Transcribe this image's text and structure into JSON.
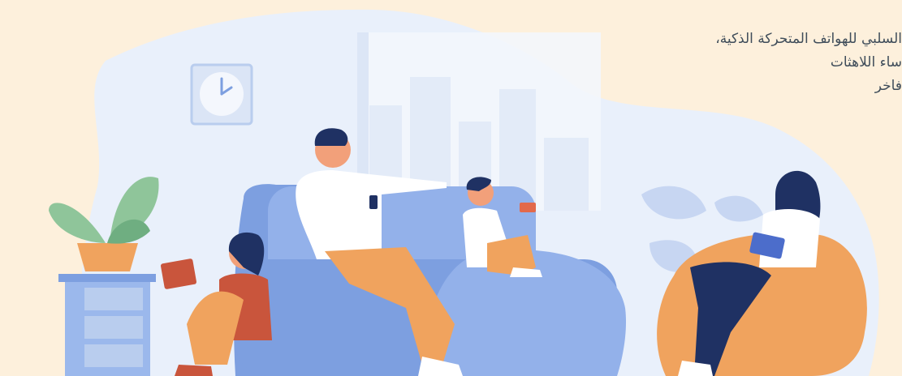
{
  "text": {
    "line1": "السلبي للهواتف المتحركة الذكية،",
    "line2": "ساء  اللاهثات",
    "line3": "فاخر"
  },
  "colors": {
    "background": "#fdf0dc",
    "blob": "#e9f0fb",
    "sofa": "#7d9fe0",
    "orange": "#f0a35e",
    "shirt": "#ffffff",
    "hair": "#1f3163",
    "skin": "#f2a07a"
  },
  "icons": [
    "wall-clock-icon",
    "potted-plant-icon",
    "smartphone-icon",
    "tablet-icon",
    "game-controller-icon"
  ]
}
